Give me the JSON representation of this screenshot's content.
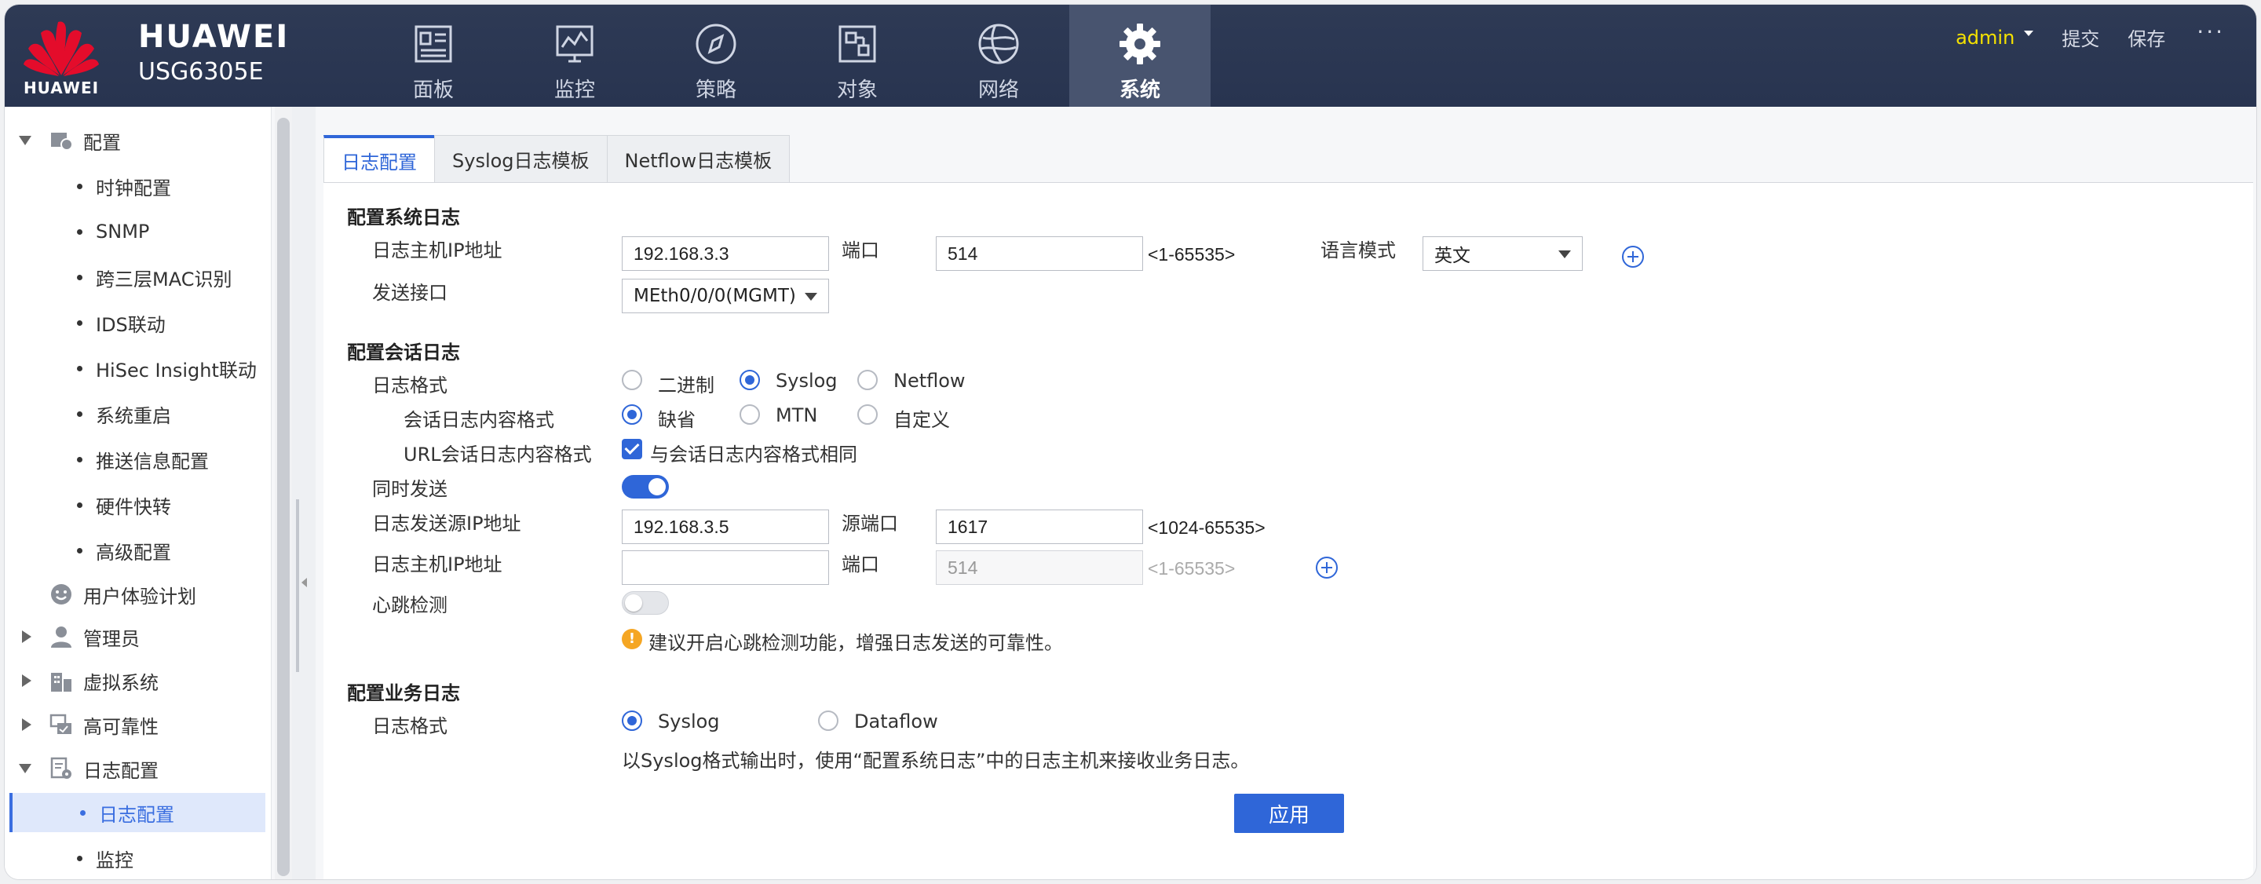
{
  "header": {
    "logo_text": "HUAWEI",
    "brand_name": "HUAWEI",
    "model": "USG6305E",
    "nav": [
      {
        "label": "面板",
        "icon": "dashboard-icon"
      },
      {
        "label": "监控",
        "icon": "monitor-icon"
      },
      {
        "label": "策略",
        "icon": "policy-icon"
      },
      {
        "label": "对象",
        "icon": "object-icon"
      },
      {
        "label": "网络",
        "icon": "network-icon"
      },
      {
        "label": "系统",
        "icon": "gear-icon",
        "active": true
      }
    ],
    "user": "admin",
    "submit": "提交",
    "save": "保存",
    "more": "···"
  },
  "sidebar": {
    "config": "配置",
    "config_children": [
      "时钟配置",
      "SNMP",
      "跨三层MAC识别",
      "IDS联动",
      "HiSec Insight联动",
      "系统重启",
      "推送信息配置",
      "硬件快转",
      "高级配置"
    ],
    "ux_plan": "用户体验计划",
    "admin": "管理员",
    "vsys": "虚拟系统",
    "ha": "高可靠性",
    "log_config": "日志配置",
    "log_children": [
      "日志配置",
      "监控"
    ]
  },
  "tabs": [
    "日志配置",
    "Syslog日志模板",
    "Netflow日志模板"
  ],
  "sys_log": {
    "title": "配置系统日志",
    "host_ip_label": "日志主机IP地址",
    "host_ip": "192.168.3.3",
    "port_label": "端口",
    "port": "514",
    "port_range": "<1-65535>",
    "lang_label": "语言模式",
    "lang": "英文",
    "iface_label": "发送接口",
    "iface": "MEth0/0/0(MGMT)"
  },
  "session_log": {
    "title": "配置会话日志",
    "format_label": "日志格式",
    "formats": [
      "二进制",
      "Syslog",
      "Netflow"
    ],
    "content_label": "会话日志内容格式",
    "contents": [
      "缺省",
      "MTN",
      "自定义"
    ],
    "url_label": "URL会话日志内容格式",
    "url_same": "与会话日志内容格式相同",
    "simul_label": "同时发送",
    "src_ip_label": "日志发送源IP地址",
    "src_ip": "192.168.3.5",
    "src_port_label": "源端口",
    "src_port": "1617",
    "src_port_range": "<1024-65535>",
    "host_ip_label": "日志主机IP地址",
    "host_ip": "",
    "port_label": "端口",
    "port_placeholder": "514",
    "port_range": "<1-65535>",
    "heartbeat_label": "心跳检测",
    "heartbeat_tip": "建议开启心跳检测功能，增强日志发送的可靠性。"
  },
  "biz_log": {
    "title": "配置业务日志",
    "format_label": "日志格式",
    "formats": [
      "Syslog",
      "Dataflow"
    ],
    "note": "以Syslog格式输出时，使用“配置系统日志”中的日志主机来接收业务日志。"
  },
  "apply": "应用",
  "colors": {
    "accent": "#2f66d8",
    "header_bg": "#2b3752",
    "user": "#f5e200",
    "warning": "#f5a623"
  }
}
